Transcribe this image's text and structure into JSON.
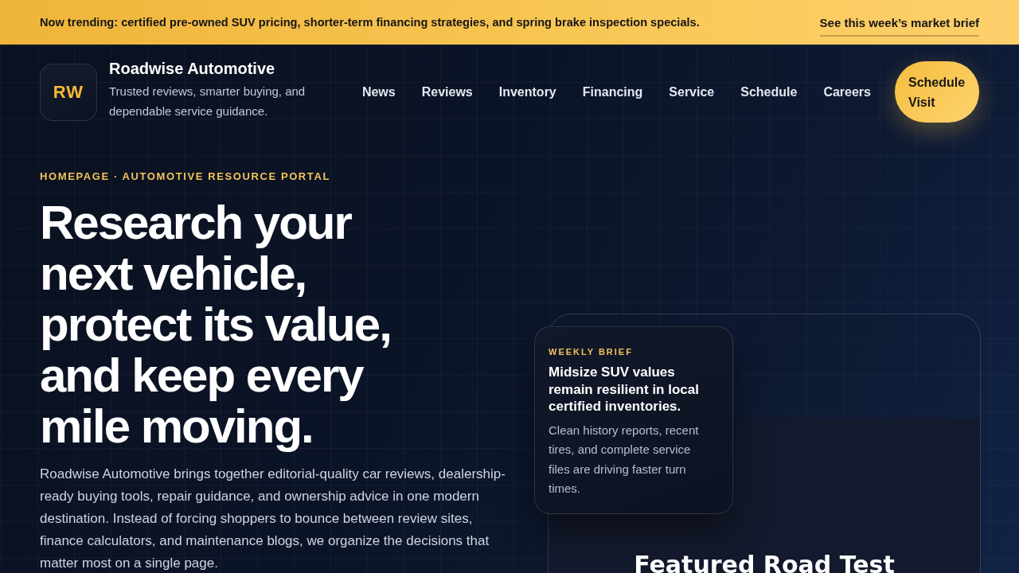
{
  "announcement": {
    "text": "Now trending: certified pre-owned SUV pricing, shorter-term financing strategies, and spring brake inspection specials.",
    "link": "See this week’s market brief"
  },
  "header": {
    "logo": "RW",
    "brand": "Roadwise Automotive",
    "tagline": "Trusted reviews, smarter buying, and dependable service guidance.",
    "nav": [
      "News",
      "Reviews",
      "Inventory",
      "Financing",
      "Service",
      "Schedule",
      "Careers"
    ],
    "cta": "Schedule Visit"
  },
  "hero": {
    "eyebrow": "HOMEPAGE · AUTOMOTIVE RESOURCE PORTAL",
    "headline": "Research your next vehicle, protect its value, and keep every mile moving.",
    "intro": "Roadwise Automotive brings together editorial-quality car reviews, dealership-ready buying tools, repair guidance, and ownership advice in one modern destination. Instead of forcing shoppers to bounce between review sites, finance calculators, and maintenance blogs, we organize the decisions that matter most on a single page."
  },
  "featured": {
    "title": "Featured Road Test",
    "brief": {
      "eyebrow": "WEEKLY BRIEF",
      "title": "Midsize SUV values remain resilient in local certified inventories.",
      "body": "Clean history reports, recent tires, and complete service files are driving faster turn times."
    }
  }
}
